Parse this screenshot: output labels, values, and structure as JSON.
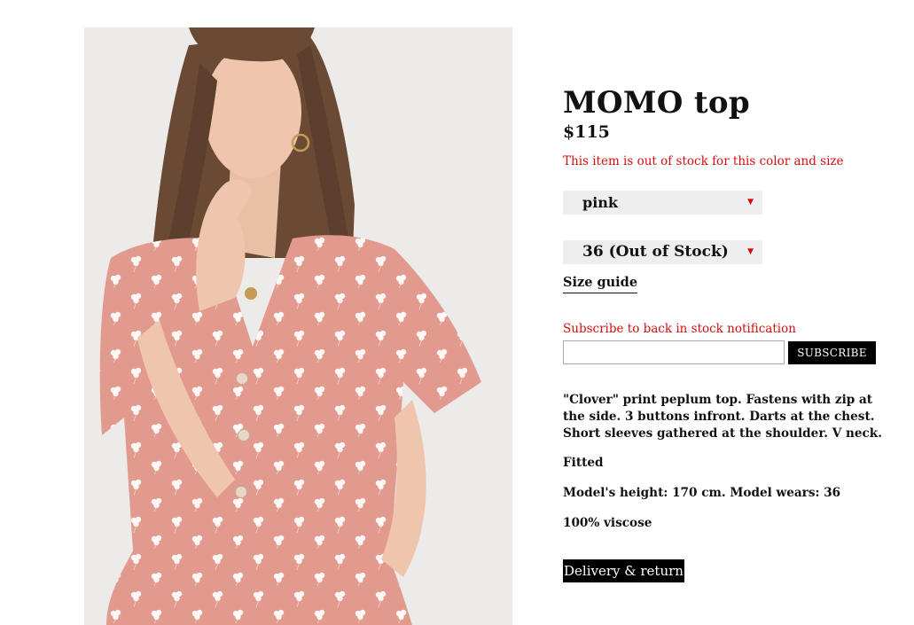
{
  "product": {
    "image_alt": "Model wearing pink clover print top",
    "title": "MOMO top",
    "price": "$115",
    "stock_message": "This item is out of stock for this color and size"
  },
  "options": {
    "color": {
      "selected": "pink",
      "arrow_icon": "dropdown-arrow-icon"
    },
    "size": {
      "selected": "36 (Out of Stock)",
      "arrow_icon": "dropdown-arrow-icon"
    },
    "size_guide_label": "Size guide"
  },
  "subscribe": {
    "label": "Subscribe to back in stock notification",
    "input_value": "",
    "input_placeholder": "",
    "button_label": "SUBSCRIBE"
  },
  "description": {
    "text": "\"Clover\" print peplum top. Fastens with zip at the side. 3 buttons infront. Darts at the chest. Short sleeves gathered at the shoulder. V neck.",
    "fit": "Fitted",
    "model_info": "Model's height: 170 cm. Model wears: 36",
    "material": "100% viscose"
  },
  "delivery": {
    "button_label": "Delivery & return"
  },
  "colors": {
    "accent_red": "#d10f0f",
    "button_black": "#000000",
    "select_bg": "#eeeeee",
    "top_pink": "#e29a8f"
  }
}
